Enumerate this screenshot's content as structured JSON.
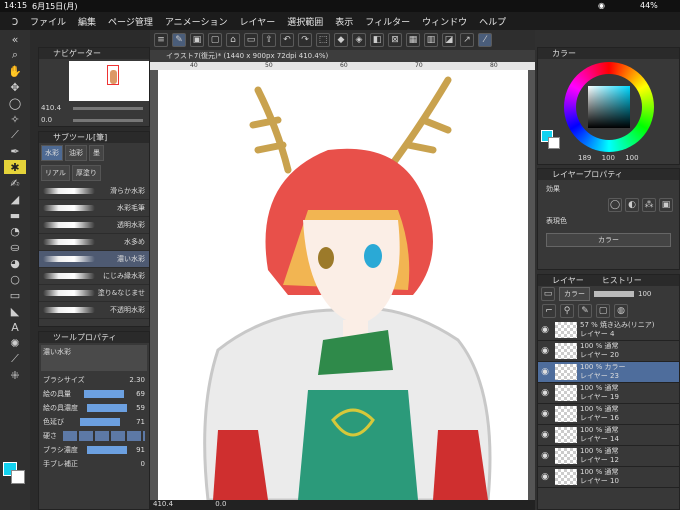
{
  "status": {
    "time": "14:15",
    "date": "6月15日(月)",
    "battery": "44%"
  },
  "menu": [
    "ファイル",
    "編集",
    "ページ管理",
    "アニメーション",
    "レイヤー",
    "選択範囲",
    "表示",
    "フィルター",
    "ウィンドウ",
    "ヘルプ"
  ],
  "navigator": {
    "title": "ナビゲーター",
    "zoom": "410.4",
    "angle": "0.0"
  },
  "subtool": {
    "title": "サブツール[筆]",
    "tabs": [
      "水彩",
      "油彩",
      "墨",
      "リアル",
      "厚塗り"
    ],
    "brushes": [
      "滑らか水彩",
      "水彩毛筆",
      "透明水彩",
      "水多め",
      "濃い水彩",
      "にじみ縁水彩",
      "塗り&なじませ",
      "不透明水彩"
    ],
    "selected_index": 4
  },
  "toolprop": {
    "title": "ツールプロパティ",
    "brush_name": "濃い水彩",
    "rows": [
      {
        "label": "ブラシサイズ",
        "value": "2.30"
      },
      {
        "label": "絵の具量",
        "value": "69"
      },
      {
        "label": "絵の具濃度",
        "value": "59"
      },
      {
        "label": "色延び",
        "value": "71"
      },
      {
        "label": "硬さ",
        "value": ""
      },
      {
        "label": "ブラシ濃度",
        "value": "91"
      },
      {
        "label": "手ブレ補正",
        "value": "0"
      }
    ]
  },
  "canvas": {
    "tab": "イラスト7(復元)* (1440 x 900px 72dpi 410.4%)",
    "ruler": [
      "40",
      "50",
      "60",
      "70",
      "80"
    ],
    "bottom_zoom": "410.4",
    "bottom_angle": "0.0"
  },
  "color": {
    "title": "カラー",
    "h": "189",
    "s": "100",
    "v": "100"
  },
  "layerprop": {
    "title": "レイヤープロパティ",
    "effect_label": "効果",
    "express_label": "表現色",
    "express_value": "カラー"
  },
  "layers": {
    "tab": "レイヤー",
    "tab2": "ヒストリー",
    "blend": "カラー",
    "opacity": "100",
    "items": [
      {
        "line1": "57 % 焼き込み(リニア)",
        "line2": "レイヤー 4"
      },
      {
        "line1": "100 % 通常",
        "line2": "レイヤー 20"
      },
      {
        "line1": "100 % カラー",
        "line2": "レイヤー 23"
      },
      {
        "line1": "100 % 通常",
        "line2": "レイヤー 19"
      },
      {
        "line1": "100 % 通常",
        "line2": "レイヤー 16"
      },
      {
        "line1": "100 % 通常",
        "line2": "レイヤー 14"
      },
      {
        "line1": "100 % 通常",
        "line2": "レイヤー 12"
      },
      {
        "line1": "100 % 通常",
        "line2": "レイヤー 10"
      }
    ],
    "selected_index": 2
  }
}
